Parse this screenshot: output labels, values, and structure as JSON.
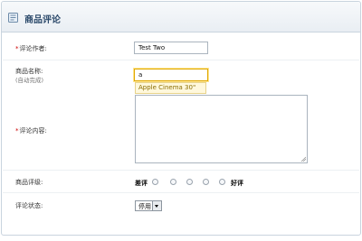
{
  "header": {
    "title": "商品评论",
    "icon": "page-icon"
  },
  "form": {
    "author": {
      "required_mark": "*",
      "label": "评论作者:",
      "value": "Test Two"
    },
    "product": {
      "label": "商品名称:",
      "hint": "(自动完成)",
      "value": "a",
      "suggestion": "Apple Cinema 30\""
    },
    "content": {
      "required_mark": "*",
      "label": "评论内容:",
      "value": ""
    },
    "rating": {
      "label": "商品评级:",
      "low_label": "差评",
      "high_label": "好评",
      "options": 5
    },
    "status": {
      "label": "评论状态:",
      "selected": "停用"
    }
  }
}
